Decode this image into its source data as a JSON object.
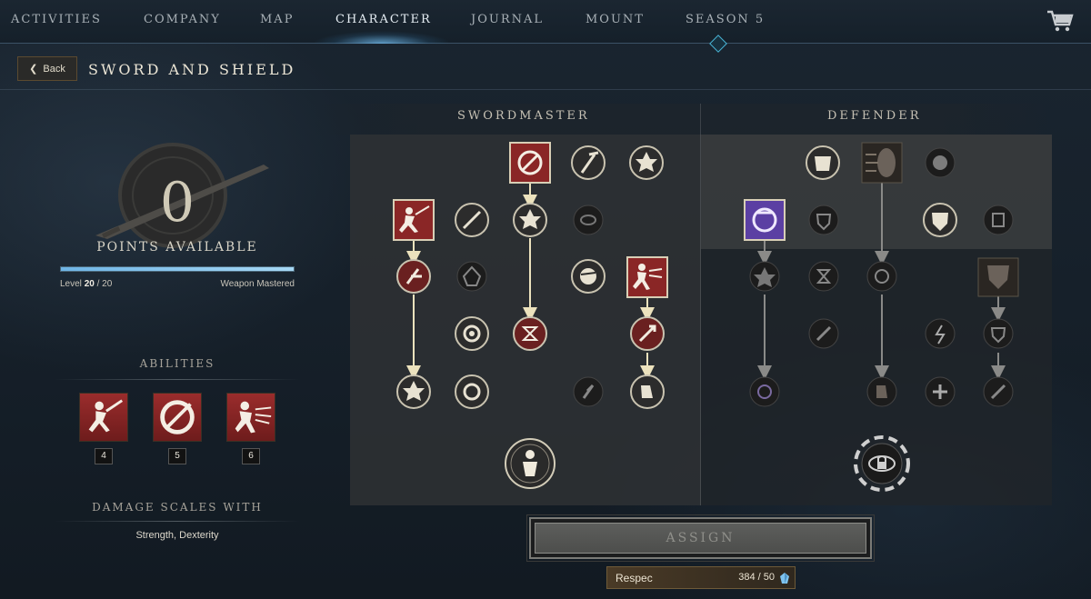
{
  "nav": {
    "tabs": [
      {
        "label": "ACTIVITIES",
        "active": false
      },
      {
        "label": "COMPANY",
        "active": false
      },
      {
        "label": "MAP",
        "active": false
      },
      {
        "label": "CHARACTER",
        "active": true
      },
      {
        "label": "JOURNAL",
        "active": false
      },
      {
        "label": "MOUNT",
        "active": false
      },
      {
        "label": "SEASON 5",
        "active": false
      }
    ],
    "cart_icon": "cart-icon"
  },
  "header": {
    "back_label": "Back",
    "title": "SWORD AND SHIELD"
  },
  "mastery": {
    "points": "0",
    "points_label": "POINTS AVAILABLE",
    "level_prefix": "Level",
    "level_current": "20",
    "level_max": "/ 20",
    "level_progress": 1.0,
    "mastered_label": "Weapon Mastered"
  },
  "abilities": {
    "heading": "ABILITIES",
    "slots": [
      {
        "key": "4",
        "icon": "sword-lunge-icon"
      },
      {
        "key": "5",
        "icon": "whirlwind-slash-icon"
      },
      {
        "key": "6",
        "icon": "shield-rush-icon"
      }
    ]
  },
  "damage": {
    "heading": "DAMAGE SCALES WITH",
    "value": "Strength, Dexterity"
  },
  "trees": {
    "left_title": "SWORDMASTER",
    "right_title": "DEFENDER"
  },
  "actions": {
    "assign_label": "ASSIGN",
    "respec_label": "Respec",
    "respec_count": "384 / 50",
    "respec_icon": "azoth-crystal-icon"
  },
  "colors": {
    "accent_blue": "#6fb5e6",
    "ability_red": "#8a2626",
    "node_link": "#e6dcb8",
    "defender_purple": "#6a4bb0"
  }
}
